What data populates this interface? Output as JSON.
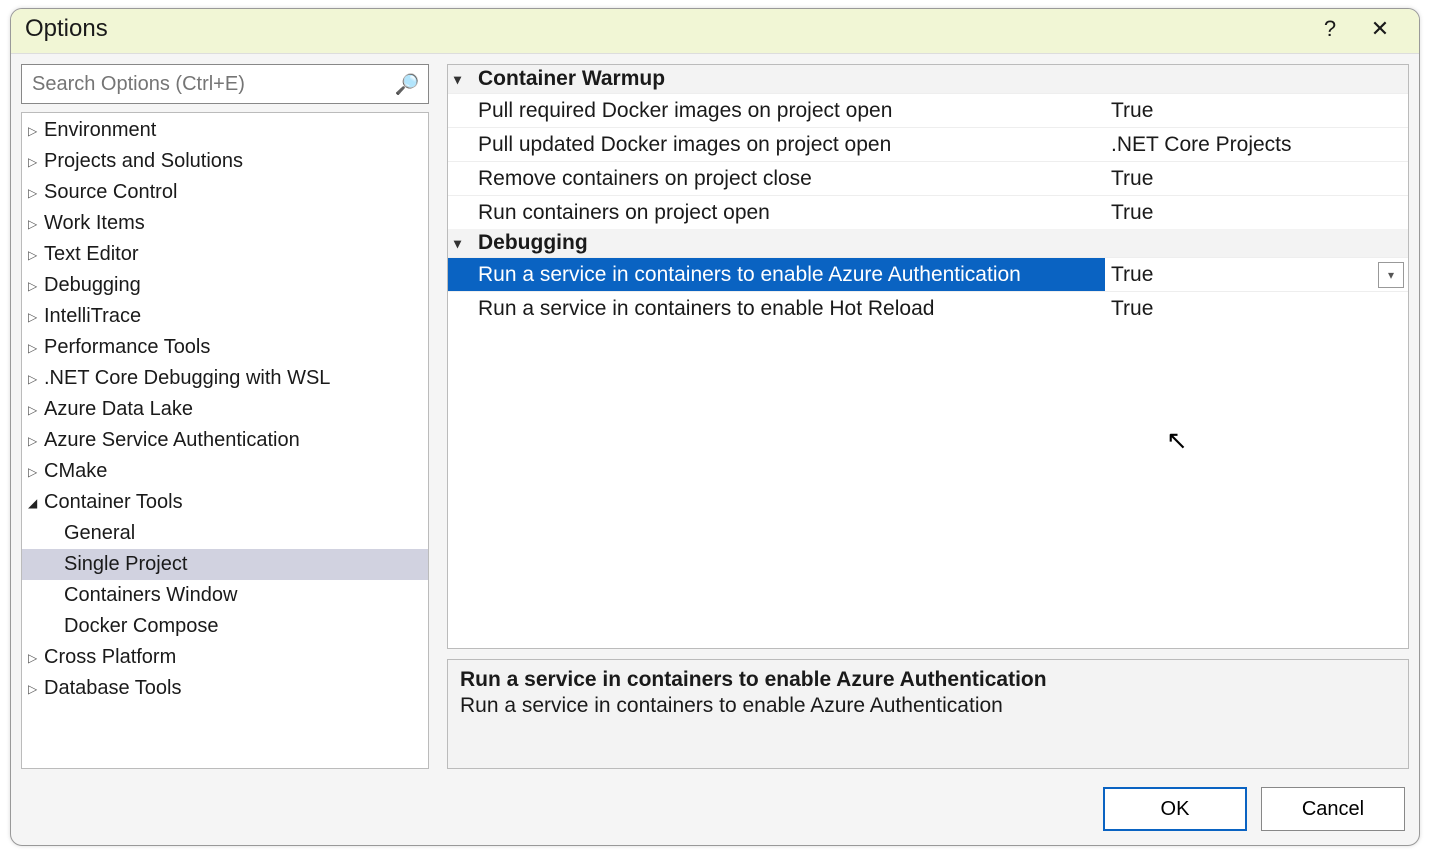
{
  "dialog": {
    "title": "Options",
    "help_tooltip": "?",
    "close_tooltip": "✕"
  },
  "search": {
    "placeholder": "Search Options (Ctrl+E)"
  },
  "tree": [
    {
      "label": "Environment",
      "expanded": false,
      "depth": 0
    },
    {
      "label": "Projects and Solutions",
      "expanded": false,
      "depth": 0
    },
    {
      "label": "Source Control",
      "expanded": false,
      "depth": 0
    },
    {
      "label": "Work Items",
      "expanded": false,
      "depth": 0
    },
    {
      "label": "Text Editor",
      "expanded": false,
      "depth": 0
    },
    {
      "label": "Debugging",
      "expanded": false,
      "depth": 0
    },
    {
      "label": "IntelliTrace",
      "expanded": false,
      "depth": 0
    },
    {
      "label": "Performance Tools",
      "expanded": false,
      "depth": 0
    },
    {
      "label": ".NET Core Debugging with WSL",
      "expanded": false,
      "depth": 0
    },
    {
      "label": "Azure Data Lake",
      "expanded": false,
      "depth": 0
    },
    {
      "label": "Azure Service Authentication",
      "expanded": false,
      "depth": 0
    },
    {
      "label": "CMake",
      "expanded": false,
      "depth": 0
    },
    {
      "label": "Container Tools",
      "expanded": true,
      "depth": 0
    },
    {
      "label": "General",
      "leaf": true,
      "depth": 1
    },
    {
      "label": "Single Project",
      "leaf": true,
      "depth": 1,
      "selected": true
    },
    {
      "label": "Containers Window",
      "leaf": true,
      "depth": 1
    },
    {
      "label": "Docker Compose",
      "leaf": true,
      "depth": 1
    },
    {
      "label": "Cross Platform",
      "expanded": false,
      "depth": 0
    },
    {
      "label": "Database Tools",
      "expanded": false,
      "depth": 0
    }
  ],
  "propgrid": {
    "categories": [
      {
        "name": "Container Warmup",
        "rows": [
          {
            "label": "Pull required Docker images on project open",
            "value": "True"
          },
          {
            "label": "Pull updated Docker images on project open",
            "value": ".NET Core Projects"
          },
          {
            "label": "Remove containers on project close",
            "value": "True"
          },
          {
            "label": "Run containers on project open",
            "value": "True"
          }
        ]
      },
      {
        "name": "Debugging",
        "rows": [
          {
            "label": "Run a service in containers to enable Azure Authentication",
            "value": "True",
            "selected": true
          },
          {
            "label": "Run a service in containers to enable Hot Reload",
            "value": "True"
          }
        ]
      }
    ]
  },
  "description": {
    "title": "Run a service in containers to enable Azure Authentication",
    "body": "Run a service in containers to enable Azure Authentication"
  },
  "footer": {
    "ok": "OK",
    "cancel": "Cancel"
  }
}
